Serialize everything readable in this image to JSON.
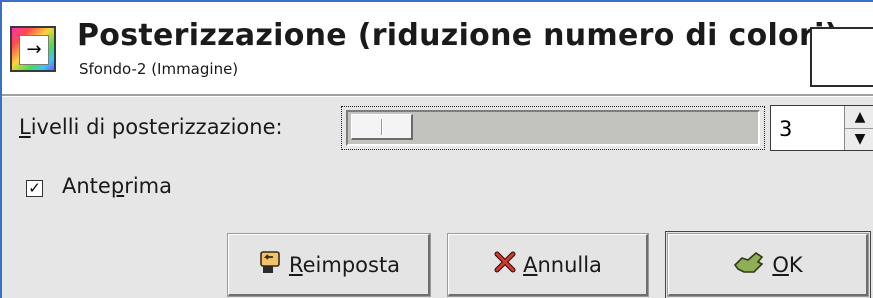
{
  "header": {
    "title": "Posterizzazione (riduzione numero di colori)",
    "subtitle": "Sfondo-2 (Immagine)",
    "icon": "posterize-tool-icon"
  },
  "levels": {
    "label_mnemonic": "L",
    "label_rest": "ivelli di posterizzazione:",
    "value": "3",
    "slider_min": 2,
    "slider_max": 256,
    "slider_fraction": 0.004
  },
  "preview": {
    "label_pre": "Ante",
    "label_mnemonic": "p",
    "label_post": "rima",
    "checked": true
  },
  "buttons": {
    "reset_mnemonic": "R",
    "reset_rest": "eimposta",
    "cancel_mnemonic": "A",
    "cancel_rest": "nnulla",
    "ok_mnemonic": "O",
    "ok_rest": "K"
  },
  "colors": {
    "accent": "#3b6fc9",
    "dialog_bg": "#e6e6e6",
    "cancel_icon": "#c0392b",
    "ok_icon": "#6a8f3a",
    "reset_icon": "#e0902a"
  }
}
